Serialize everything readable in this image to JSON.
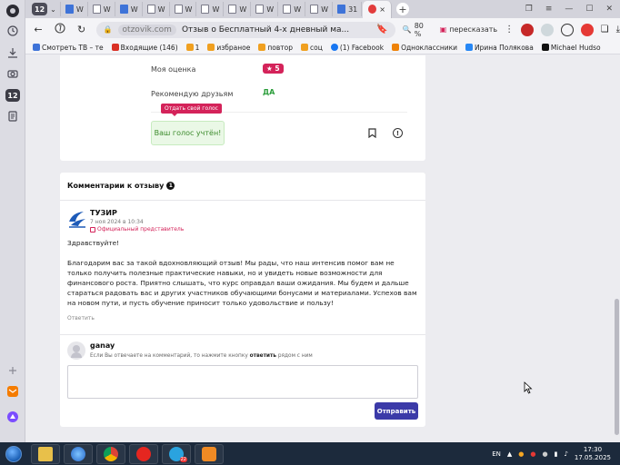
{
  "browser": {
    "tab_count": "12",
    "tabs": [
      {
        "label": "W",
        "icon": "doc-icon"
      },
      {
        "label": "W",
        "icon": "doc-icon"
      },
      {
        "label": "W",
        "icon": "doc-icon"
      },
      {
        "label": "W",
        "icon": "doc-icon"
      },
      {
        "label": "W",
        "icon": "doc-icon"
      },
      {
        "label": "W",
        "icon": "doc-icon"
      },
      {
        "label": "W",
        "icon": "doc-icon"
      },
      {
        "label": "W",
        "icon": "doc-icon"
      },
      {
        "label": "W",
        "icon": "doc-icon"
      },
      {
        "label": "W",
        "icon": "doc-icon"
      },
      {
        "label": "31",
        "icon": "doc-icon"
      }
    ],
    "active_tab_close": "×",
    "new_tab": "+",
    "url_domain": "otzovik.com",
    "page_title": "Отзыв о Бесплатный 4-х дневный ма...",
    "zoom": "80 %",
    "retell_label": "пересказать",
    "bookmarks": [
      {
        "label": "Смотреть ТВ – те",
        "color": "#3e73d8"
      },
      {
        "label": "Входящие (146)",
        "color": "#d93025"
      },
      {
        "label": "1",
        "color": "#f0a020"
      },
      {
        "label": "избраное",
        "color": "#f0a020"
      },
      {
        "label": "повтор",
        "color": "#f0a020"
      },
      {
        "label": "соц",
        "color": "#f0a020"
      },
      {
        "label": "(1) Facebook",
        "color": "#1877f2"
      },
      {
        "label": "Одноклассники",
        "color": "#ee8208"
      },
      {
        "label": "Ирина Полякова",
        "color": "#2787f5"
      },
      {
        "label": "Michael Hudso",
        "color": "#111111"
      }
    ]
  },
  "review": {
    "my_rating_label": "Моя оценка",
    "my_rating_value": "★ 5",
    "recommend_label": "Рекомендую друзьям",
    "recommend_value": "ДА",
    "vote_tooltip": "Отдать свой голос",
    "vote_status": "Ваш голос учтён!"
  },
  "comments": {
    "title": "Комментарии к отзыву",
    "count": "1",
    "reply": {
      "author": "ТУЗИР",
      "date": "7 ноя 2024 в 10:34",
      "role": "Официальный представитель",
      "greeting": "Здравствуйте!",
      "body": "Благодарим вас за такой вдохновляющий отзыв! Мы рады, что наш интенсив помог вам не только получить полезные практические навыки, но и увидеть новые возможности для финансового роста. Приятно слышать, что курс оправдал ваши ожидания. Мы будем и дальше стараться радовать вас и других участников обучающими бонусами и материалами. Успехов вам на новом пути, и пусть обучение приносит только удовольствие и пользу!",
      "reply_link": "Ответить"
    },
    "new_comment": {
      "user": "ganay",
      "hint_before": "Если Вы отвечаете на комментарий, то нажмите кнопку ",
      "hint_bold": "ответить",
      "hint_after": " рядом с ним",
      "placeholder": "",
      "send_label": "Отправить"
    }
  },
  "taskbar": {
    "language": "EN",
    "time": "17:30",
    "date": "17.05.2025",
    "telegram_badge": "22"
  }
}
